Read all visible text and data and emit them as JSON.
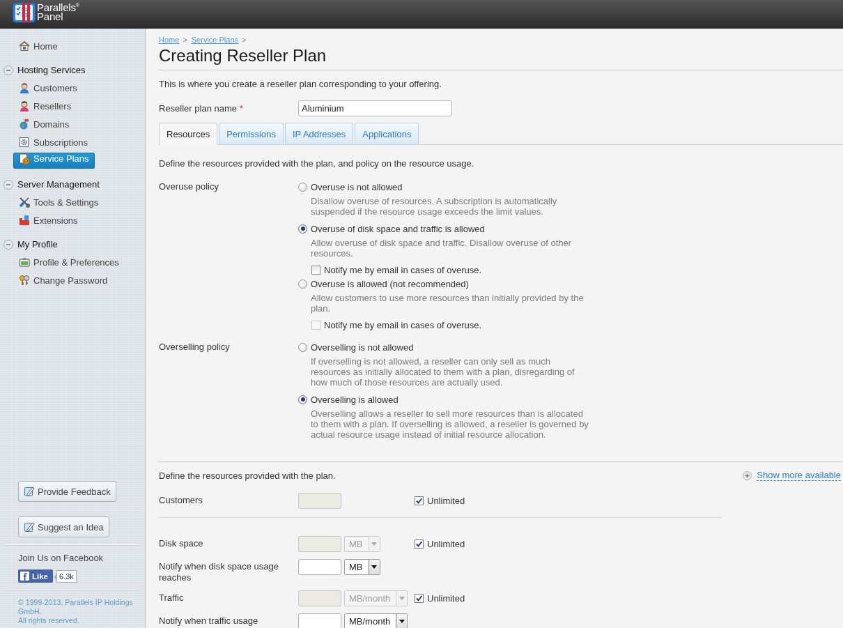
{
  "header": {
    "logo_lines": [
      "Parallels$^{®}$",
      "Panel"
    ]
  },
  "sidebar": {
    "home": {
      "label": "Home",
      "selected": false
    },
    "sections": [
      {
        "title": "Hosting Services",
        "expanded": true,
        "items": [
          {
            "label": "Customers",
            "selected": false
          },
          {
            "label": "Resellers",
            "selected": false
          },
          {
            "label": "Domains",
            "selected": false
          },
          {
            "label": "Subscriptions",
            "selected": false
          },
          {
            "label": "Service Plans",
            "selected": true
          }
        ]
      },
      {
        "title": "Server Management",
        "expanded": true,
        "items": [
          {
            "label": "Tools & Settings",
            "selected": false
          },
          {
            "label": "Extensions",
            "selected": false
          }
        ]
      },
      {
        "title": "My Profile",
        "expanded": true,
        "items": [
          {
            "label": "Profile & Preferences",
            "selected": false
          },
          {
            "label": "Change Password",
            "selected": false
          }
        ]
      }
    ],
    "buttons": [
      "Provide Feedback",
      "Suggest an Idea"
    ],
    "facebook": {
      "title": "Join Us on Facebook",
      "like_label": "Like",
      "like_count": "6.3k"
    },
    "copyright": [
      "© 1999-2013. Parallels IP Holdings GmbH.",
      "All rights reserved."
    ]
  },
  "breadcrumbs": [
    {
      "label": "Home",
      "separator": ">"
    },
    {
      "label": "Service Plans",
      "separator": ">"
    }
  ],
  "title": "Creating Reseller Plan",
  "intro": "This is where you create a reseller plan corresponding to your offering.",
  "plan_name": {
    "label": "Reseller plan name",
    "required_mark": "*",
    "value": "Aluminium"
  },
  "tabs": [
    {
      "label": "Resources",
      "selected": true
    },
    {
      "label": "Permissions",
      "selected": false
    },
    {
      "label": "IP Addresses",
      "selected": false
    },
    {
      "label": "Applications",
      "selected": false
    }
  ],
  "resources": {
    "intro": "Define the resources provided with the plan, and policy on the resource usage.",
    "policies": [
      {
        "label": "Overuse policy",
        "options": [
          {
            "label": "Overuse is not allowed",
            "selected": false,
            "description": "Disallow overuse of resources. A subscription is automatically suspended if the resource usage exceeds the limit values."
          },
          {
            "label": "Overuse of disk space and traffic is allowed",
            "selected": true,
            "description": "Allow overuse of disk space and traffic. Disallow overuse of other resources.",
            "notify": {
              "label": "Notify me by email in cases of overuse.",
              "checked": false,
              "disabled": false
            }
          },
          {
            "label": "Overuse is allowed (not recommended)",
            "selected": false,
            "description": "Allow customers to use more resources than initially provided by the plan.",
            "notify": {
              "label": "Notify me by email in cases of overuse.",
              "checked": false,
              "disabled": true
            }
          }
        ]
      },
      {
        "label": "Overselling policy",
        "options": [
          {
            "label": "Overselling is not allowed",
            "selected": false,
            "description": "If overselling is not allowed, a reseller can only sell as much resources as initially allocated to them with a plan, disregarding of how much of those resources are actually used."
          },
          {
            "label": "Overselling is allowed",
            "selected": true,
            "description": "Overselling allows a reseller to sell more resources than is allocated to them with a plan. If overselling is allowed, a reseller is governed by actual resource usage instead of initial resource allocation."
          }
        ]
      }
    ]
  },
  "limits": {
    "intro": "Define the resources provided with the plan.",
    "show_more": "Show more available",
    "groups": [
      {
        "rows": [
          {
            "label": "Customers",
            "field": {
              "disabled": true
            },
            "unlimited": {
              "label": "Unlimited",
              "checked": true
            }
          }
        ]
      },
      {
        "rows": [
          {
            "label": "Disk space",
            "field": {
              "disabled": true
            },
            "unit": {
              "value": "MB",
              "disabled": true
            },
            "unlimited": {
              "label": "Unlimited",
              "checked": true
            }
          },
          {
            "label": "Notify when disk space usage reaches",
            "field": {
              "disabled": false
            },
            "unit": {
              "value": "MB",
              "disabled": false
            }
          },
          {
            "label": "Traffic",
            "field": {
              "disabled": true
            },
            "unit": {
              "value": "MB/month",
              "disabled": true
            },
            "unlimited": {
              "label": "Unlimited",
              "checked": true
            }
          },
          {
            "label": "Notify when traffic usage",
            "field": {
              "disabled": false
            },
            "unit": {
              "value": "MB/month",
              "disabled": false
            }
          }
        ]
      }
    ]
  }
}
